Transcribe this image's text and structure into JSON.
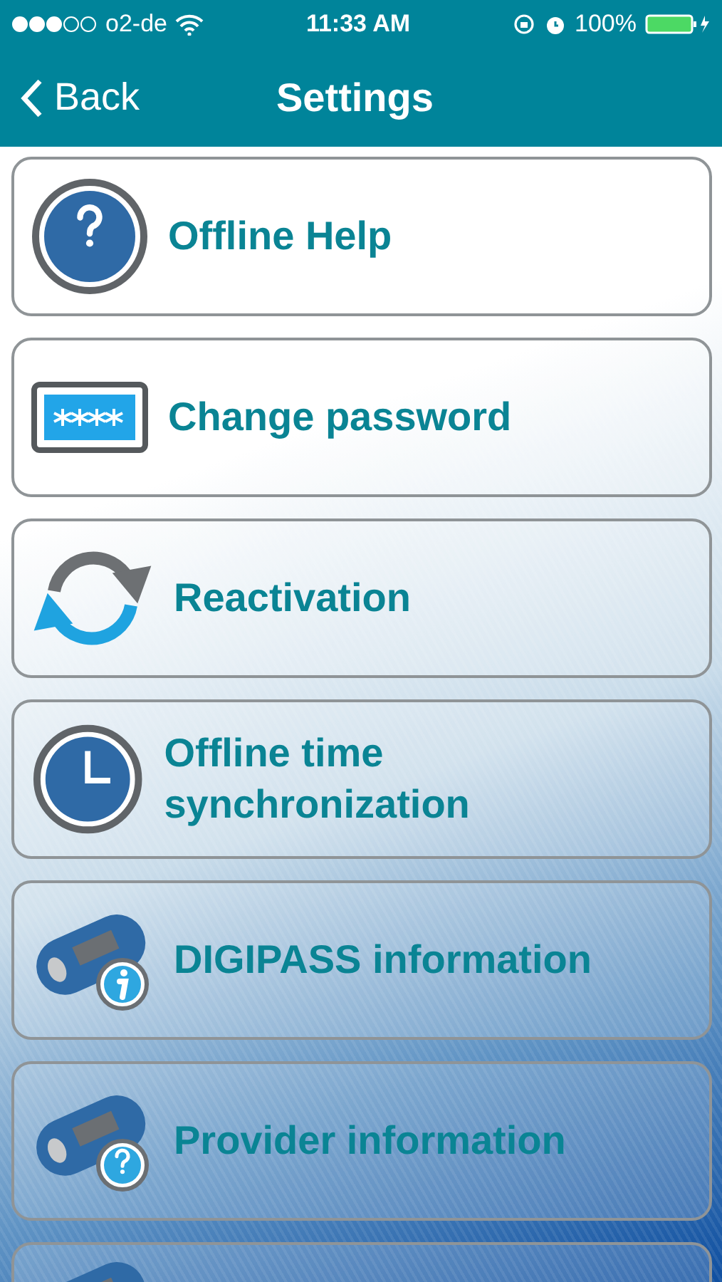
{
  "status_bar": {
    "carrier": "o2-de",
    "time": "11:33 AM",
    "battery": "100%"
  },
  "nav": {
    "back": "Back",
    "title": "Settings"
  },
  "items": [
    {
      "kind": "help",
      "label": "Offline Help"
    },
    {
      "kind": "password",
      "label": "Change password"
    },
    {
      "kind": "reactivation",
      "label": "Reactivation"
    },
    {
      "kind": "clock",
      "label": "Offline time synchronization"
    },
    {
      "kind": "token-info",
      "label": "DIGIPASS information"
    },
    {
      "kind": "token-help",
      "label": "Provider information"
    },
    {
      "kind": "token"
    }
  ]
}
